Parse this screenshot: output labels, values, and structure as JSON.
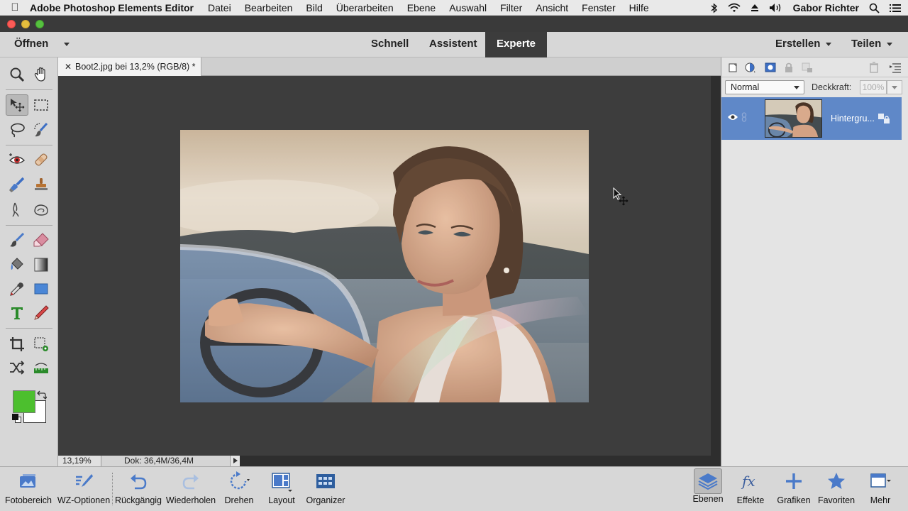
{
  "menubar": {
    "app_name": "Adobe Photoshop Elements Editor",
    "items": [
      "Datei",
      "Bearbeiten",
      "Bild",
      "Überarbeiten",
      "Ebene",
      "Auswahl",
      "Filter",
      "Ansicht",
      "Fenster",
      "Hilfe"
    ],
    "user": "Gabor Richter",
    "status_icons": [
      "bluetooth-icon",
      "wifi-icon",
      "eject-icon",
      "volume-icon"
    ]
  },
  "modebar": {
    "open_label": "Öffnen",
    "tabs": [
      {
        "label": "Schnell",
        "active": false
      },
      {
        "label": "Assistent",
        "active": false
      },
      {
        "label": "Experte",
        "active": true
      }
    ],
    "create_label": "Erstellen",
    "share_label": "Teilen"
  },
  "colors": {
    "foreground": "#4cbf2e",
    "background": "#ffffff",
    "layer_selected": "#5f88c8",
    "active_tab": "#3c3c3c",
    "canvas_bg": "#3d3d3d"
  },
  "tools": [
    "zoom-tool",
    "hand-tool",
    "move-tool",
    "marquee-tool",
    "lasso-tool",
    "quick-selection-tool",
    "red-eye-tool",
    "spot-healing-tool",
    "smart-brush-tool",
    "clone-stamp-tool",
    "blur-tool",
    "sponge-tool",
    "brush-tool",
    "eraser-tool",
    "paint-bucket-tool",
    "gradient-tool",
    "eyedropper-tool",
    "shape-tool",
    "type-tool",
    "pencil-tool",
    "crop-tool",
    "recompose-tool",
    "content-aware-move-tool",
    "straighten-tool"
  ],
  "document": {
    "tab_title": "Boot2.jpg bei 13,2% (RGB/8) *",
    "zoom": "13,19%",
    "doc_size": "Dok: 36,4M/36,4M"
  },
  "layers_panel": {
    "blend_mode": "Normal",
    "opacity_label": "Deckkraft:",
    "opacity_value": "100%",
    "layer_name": "Hintergru..."
  },
  "bottombar": {
    "items": [
      {
        "label": "Fotobereich",
        "icon": "photo-bin-icon"
      },
      {
        "label": "WZ-Optionen",
        "icon": "tool-options-icon"
      },
      {
        "label": "Rückgängig",
        "icon": "undo-icon"
      },
      {
        "label": "Wiederholen",
        "icon": "redo-icon"
      },
      {
        "label": "Drehen",
        "icon": "rotate-icon"
      },
      {
        "label": "Layout",
        "icon": "layout-icon"
      },
      {
        "label": "Organizer",
        "icon": "organizer-icon"
      },
      {
        "label": "Ebenen",
        "icon": "layers-icon"
      },
      {
        "label": "Effekte",
        "icon": "effects-icon"
      },
      {
        "label": "Grafiken",
        "icon": "graphics-icon"
      },
      {
        "label": "Favoriten",
        "icon": "favorites-icon"
      },
      {
        "label": "Mehr",
        "icon": "more-icon"
      }
    ]
  }
}
